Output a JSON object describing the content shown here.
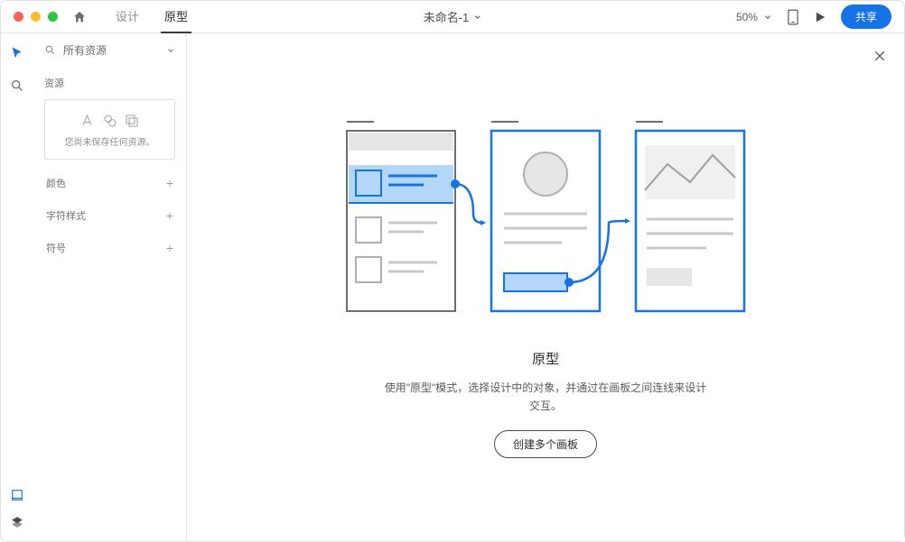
{
  "topbar": {
    "tabs": {
      "design": "设计",
      "prototype": "原型"
    },
    "doc_title": "未命名-1",
    "zoom": "50%",
    "share": "共享"
  },
  "sidepanel": {
    "search_label": "所有资源",
    "assets_label": "资源",
    "empty_msg": "您尚未保存任何资源。",
    "color_label": "颜色",
    "charstyle_label": "字符样式",
    "symbol_label": "符号"
  },
  "canvas": {
    "title": "原型",
    "body": "使用\"原型\"模式，选择设计中的对象，并通过在画板之间连线来设计交互。",
    "cta": "创建多个画板"
  }
}
